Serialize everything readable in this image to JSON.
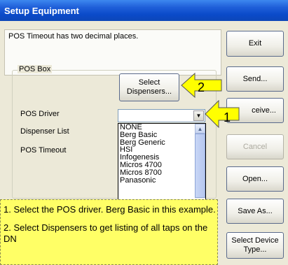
{
  "window": {
    "title": "Setup Equipment"
  },
  "message": "POS Timeout has two decimal places.",
  "pos_box": {
    "label": "POS Box",
    "select_dispensers_label": "Select\nDispensers...",
    "pos_driver_label": "POS Driver",
    "dispenser_list_label": "Dispenser List",
    "pos_timeout_label": "POS Timeout"
  },
  "driver_dropdown": {
    "selected_value": "",
    "options": [
      "NONE",
      "Berg Basic",
      "Berg Generic",
      "HSI",
      "Infogenesis",
      "Micros 4700",
      "Micros 8700",
      "Panasonic"
    ]
  },
  "side_buttons": {
    "exit": "Exit",
    "send": "Send...",
    "receive": "ceive...",
    "cancel": "Cancel",
    "open": "Open...",
    "save_as": "Save As...",
    "select_device_type": "Select Device\nType..."
  },
  "callout": {
    "line1": "1. Select the POS driver. Berg Basic in this example.",
    "line2": "2. Select Dispensers to get listing of all taps on the DN"
  },
  "arrows": {
    "arrow1": "1",
    "arrow2": "2"
  },
  "colors": {
    "title_bar": "#0a4ac9",
    "callout_bg": "#ffff66",
    "arrow_fill": "#ffff00"
  }
}
